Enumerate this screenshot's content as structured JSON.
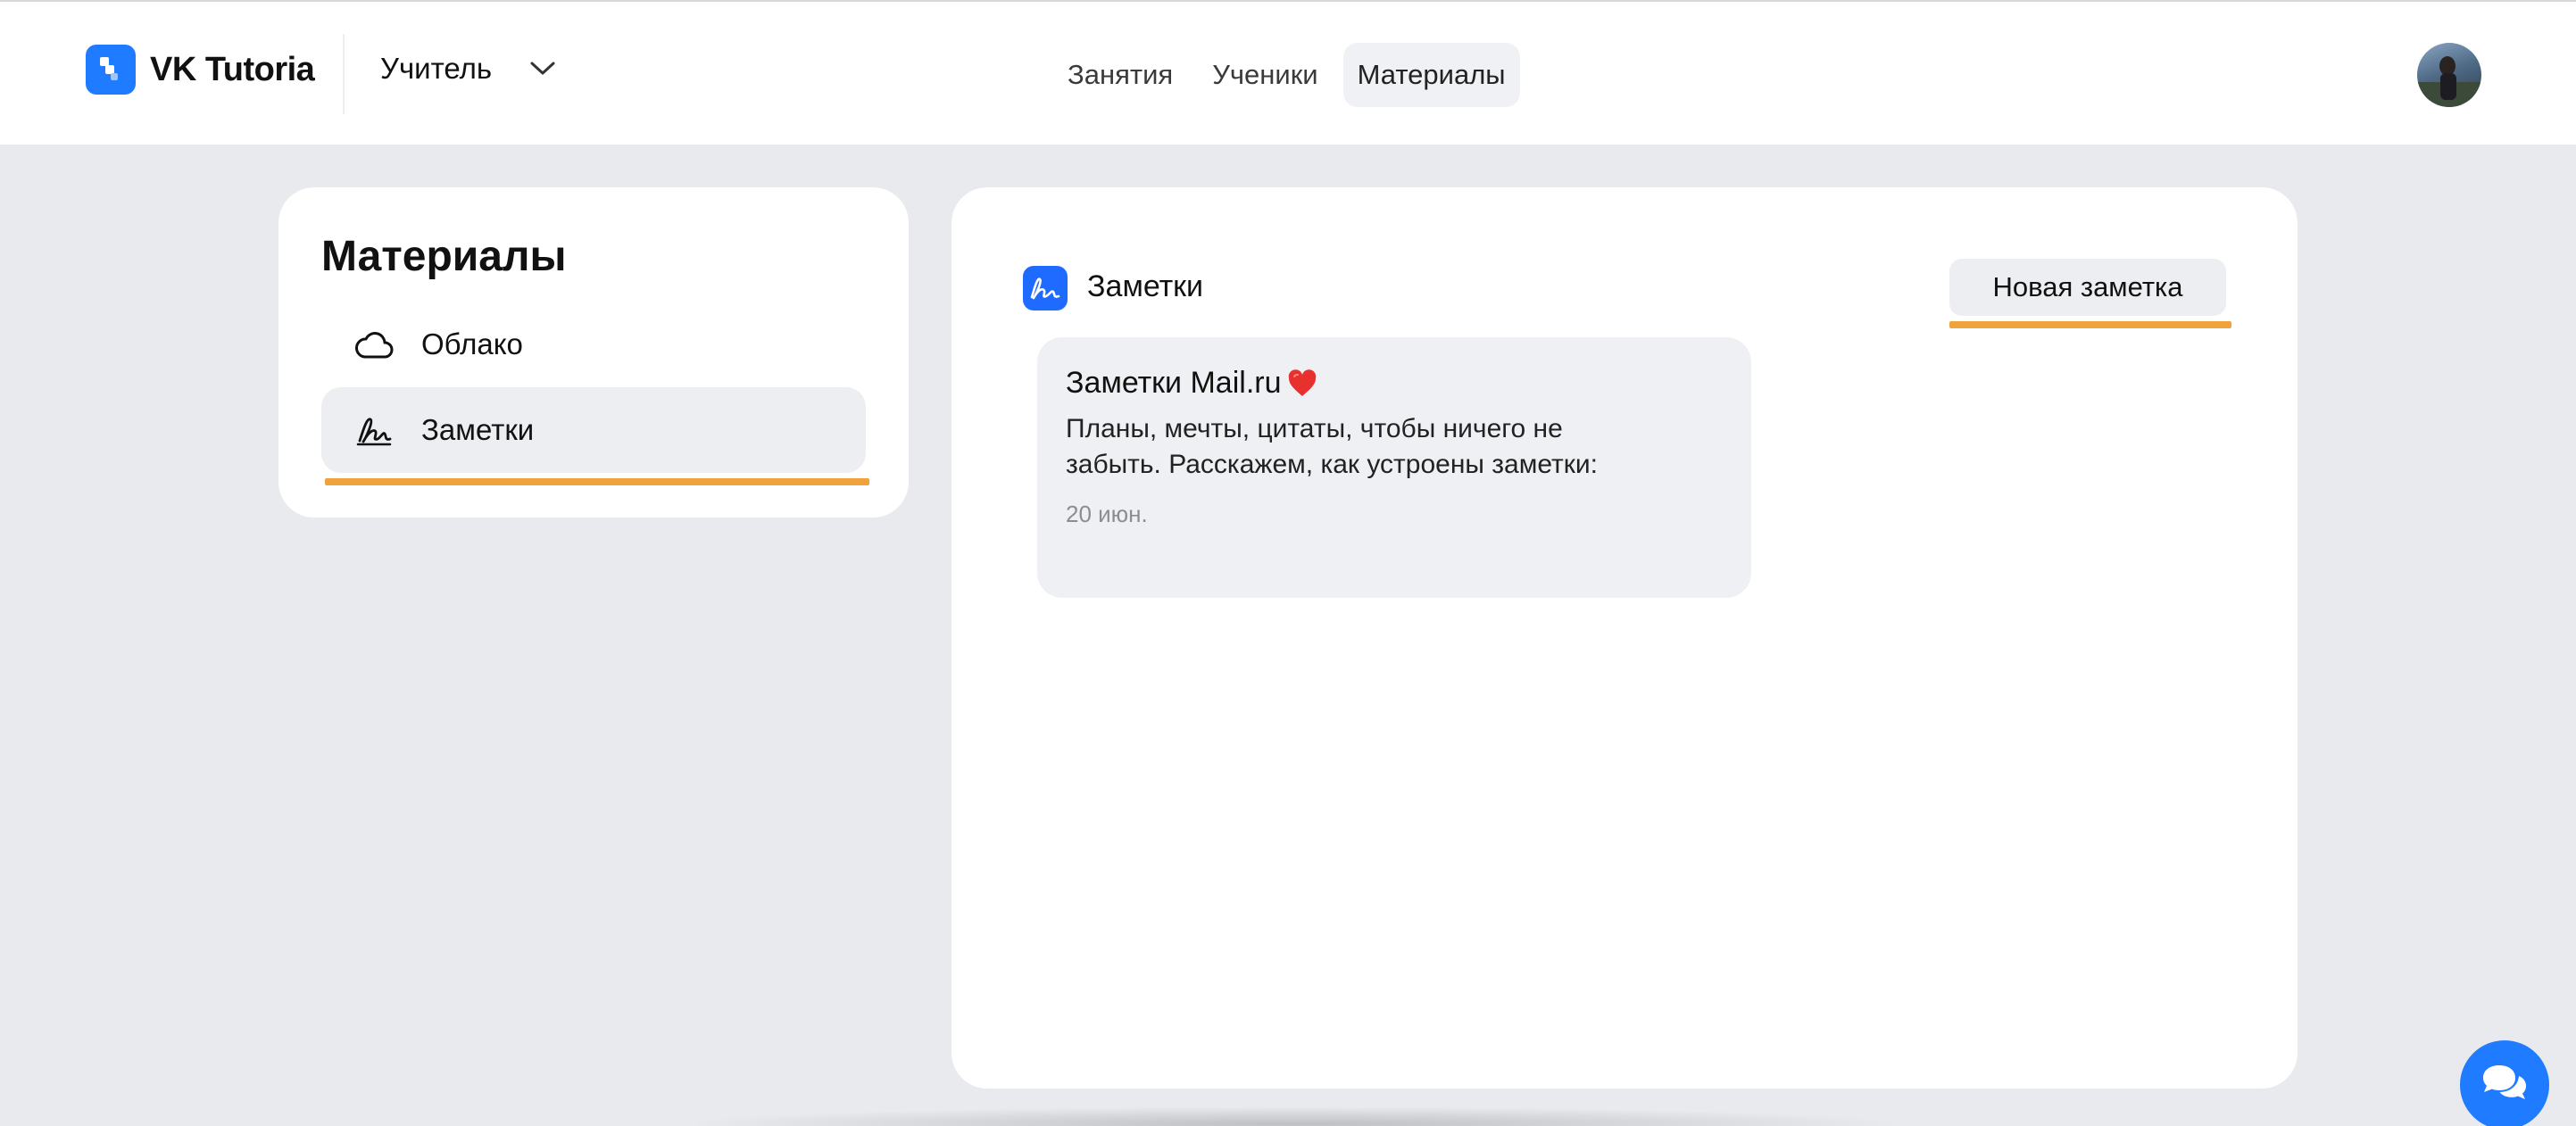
{
  "header": {
    "brand": "VK Tutoria",
    "role_label": "Учитель",
    "nav": [
      {
        "label": "Занятия",
        "active": false
      },
      {
        "label": "Ученики",
        "active": false
      },
      {
        "label": "Материалы",
        "active": true
      }
    ]
  },
  "sidebar": {
    "title": "Материалы",
    "items": [
      {
        "label": "Облако",
        "icon": "cloud-icon",
        "active": false
      },
      {
        "label": "Заметки",
        "icon": "signature-icon",
        "active": true
      }
    ]
  },
  "main": {
    "title": "Заметки",
    "new_note_label": "Новая заметка",
    "notes": [
      {
        "title": "Заметки Mail.ru",
        "body": "Планы, мечты, цитаты, чтобы ничего не забыть. Расскажем, как устроены заметки:",
        "date": "20 июн."
      }
    ]
  },
  "colors": {
    "accent": "#1f7bff",
    "highlight": "#f0a23c",
    "background": "#e8eaee",
    "card": "#ffffff"
  }
}
